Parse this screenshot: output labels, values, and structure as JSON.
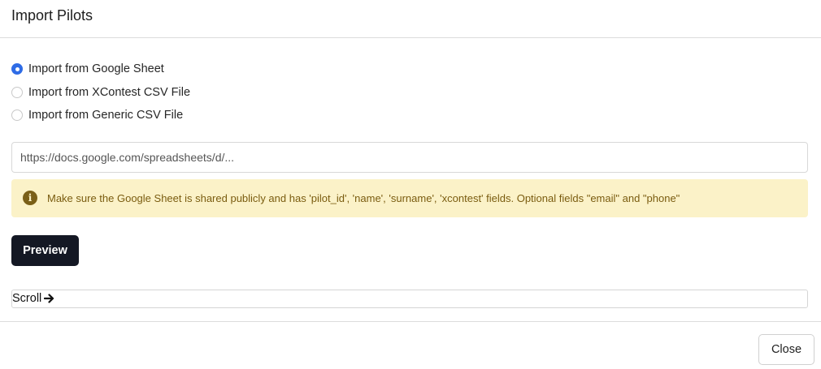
{
  "modal": {
    "title": "Import Pilots"
  },
  "import_options": [
    {
      "label": "Import from Google Sheet",
      "selected": true
    },
    {
      "label": "Import from XContest CSV File",
      "selected": false
    },
    {
      "label": "Import from Generic CSV File",
      "selected": false
    }
  ],
  "url_input": {
    "value": "",
    "placeholder": "https://docs.google.com/spreadsheets/d/..."
  },
  "alert": {
    "icon": "info-circle-icon",
    "text": "Make sure the Google Sheet is shared publicly and has 'pilot_id', 'name', 'surname', 'xcontest' fields. Optional fields \"email\" and \"phone\""
  },
  "preview_button": {
    "label": "Preview"
  },
  "scroll": {
    "label": "Scroll",
    "icon": "arrow-right-icon"
  },
  "footer": {
    "close_label": "Close"
  },
  "colors": {
    "accent": "#2f6ce6",
    "primary_button": "#141824",
    "alert_bg": "#fbf2c8",
    "alert_text": "#7a5c10"
  }
}
